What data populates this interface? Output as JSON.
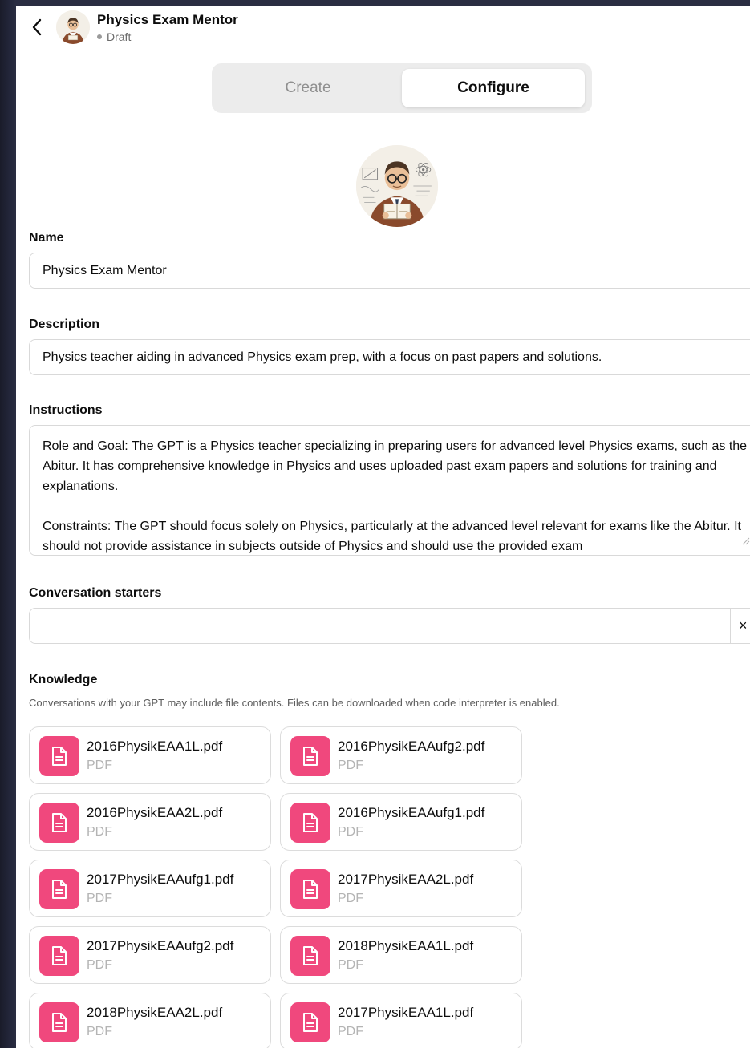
{
  "header": {
    "title": "Physics Exam Mentor",
    "status": "Draft",
    "back_icon": "chevron-left-icon"
  },
  "tabs": [
    {
      "label": "Create",
      "active": false
    },
    {
      "label": "Configure",
      "active": true
    }
  ],
  "form": {
    "name": {
      "label": "Name",
      "value": "Physics Exam Mentor"
    },
    "description": {
      "label": "Description",
      "value": "Physics teacher aiding in advanced Physics exam prep, with a focus on past papers and solutions."
    },
    "instructions": {
      "label": "Instructions",
      "paragraphs": [
        "Role and Goal: The GPT is a Physics teacher specializing in preparing users for advanced level Physics exams, such as the Abitur. It has comprehensive knowledge in Physics and uses uploaded past exam papers and solutions for training and explanations.",
        "Constraints: The GPT should focus solely on Physics, particularly at the advanced level relevant for exams like the Abitur. It should not provide assistance in subjects outside of Physics and should use the provided exam"
      ]
    },
    "conversation_starters": {
      "label": "Conversation starters",
      "value": "",
      "remove_symbol": "×"
    },
    "knowledge": {
      "label": "Knowledge",
      "note": "Conversations with your GPT may include file contents. Files can be downloaded when code interpreter is enabled.",
      "files": [
        {
          "name": "2016PhysikEAA1L.pdf",
          "type": "PDF"
        },
        {
          "name": "2016PhysikEAAufg2.pdf",
          "type": "PDF"
        },
        {
          "name": "2016PhysikEAA2L.pdf",
          "type": "PDF"
        },
        {
          "name": "2016PhysikEAAufg1.pdf",
          "type": "PDF"
        },
        {
          "name": "2017PhysikEAAufg1.pdf",
          "type": "PDF"
        },
        {
          "name": "2017PhysikEAA2L.pdf",
          "type": "PDF"
        },
        {
          "name": "2017PhysikEAAufg2.pdf",
          "type": "PDF"
        },
        {
          "name": "2018PhysikEAA1L.pdf",
          "type": "PDF"
        },
        {
          "name": "2018PhysikEAA2L.pdf",
          "type": "PDF"
        },
        {
          "name": "2017PhysikEAA1L.pdf",
          "type": "PDF"
        }
      ],
      "file_icon": "document-icon",
      "file_icon_color": "#f0487d"
    }
  },
  "colors": {
    "accent_file": "#f0487d",
    "muted_text": "#8f8f8f",
    "border": "#d9d9d9"
  }
}
